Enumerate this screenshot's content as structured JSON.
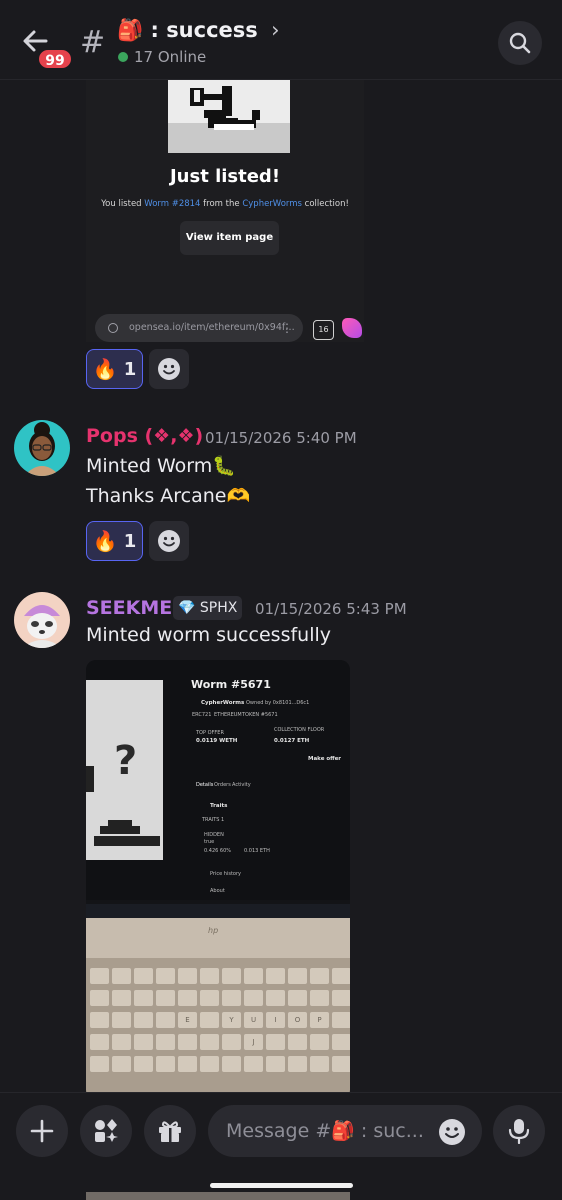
{
  "header": {
    "unread_count": "99",
    "channel_emoji": "🎒",
    "channel_name": "success",
    "online_text": "17 Online"
  },
  "shot1": {
    "title": "Just listed!",
    "text_prefix": "You listed ",
    "item": "Worm #2814",
    "text_mid": " from the ",
    "collection": "CypherWorms",
    "text_suffix": " collection!",
    "button": "View item page",
    "url": "opensea.io/item/ethereum/0x94f…",
    "tab_count": "16"
  },
  "reactions": {
    "fire_emoji": "🔥",
    "r1_count": "1",
    "r2_count": "1"
  },
  "messages": [
    {
      "username": "Pops (❖,❖)",
      "timestamp": "01/15/2026 5:40 PM",
      "line1": "Minted Worm🐛",
      "line2": "Thanks Arcane🫶"
    },
    {
      "username": "SEEKME",
      "role_emoji": "💎",
      "role": "SPHX",
      "timestamp": "01/15/2026 5:43 PM",
      "line1": "Minted worm successfully"
    }
  ],
  "photo": {
    "title": "Worm #5671",
    "collection": "CypherWorms",
    "owner": "Owned by 0x8101...D6c1",
    "chips": [
      "ERC721",
      "ETHEREUM",
      "TOKEN #5671"
    ],
    "top_offer_label": "TOP OFFER",
    "top_offer": "0.0119 WETH",
    "floor_label": "COLLECTION FLOOR",
    "floor": "0.0127 ETH",
    "make_offer": "Make offer",
    "tabs": [
      "Details",
      "Orders",
      "Activity"
    ],
    "traits": "Traits",
    "traits_count": "TRAITS 1",
    "hidden": "HIDDEN",
    "hidden_val": "true",
    "pct": "0.426 60%",
    "eth": "0.013 ETH",
    "price_history": "Price history",
    "about": "About",
    "brand": "hp",
    "keys": [
      "Y",
      "U",
      "I",
      "O",
      "P",
      "E",
      "J"
    ]
  },
  "composer": {
    "placeholder": "Message #🎒 : suc..."
  }
}
